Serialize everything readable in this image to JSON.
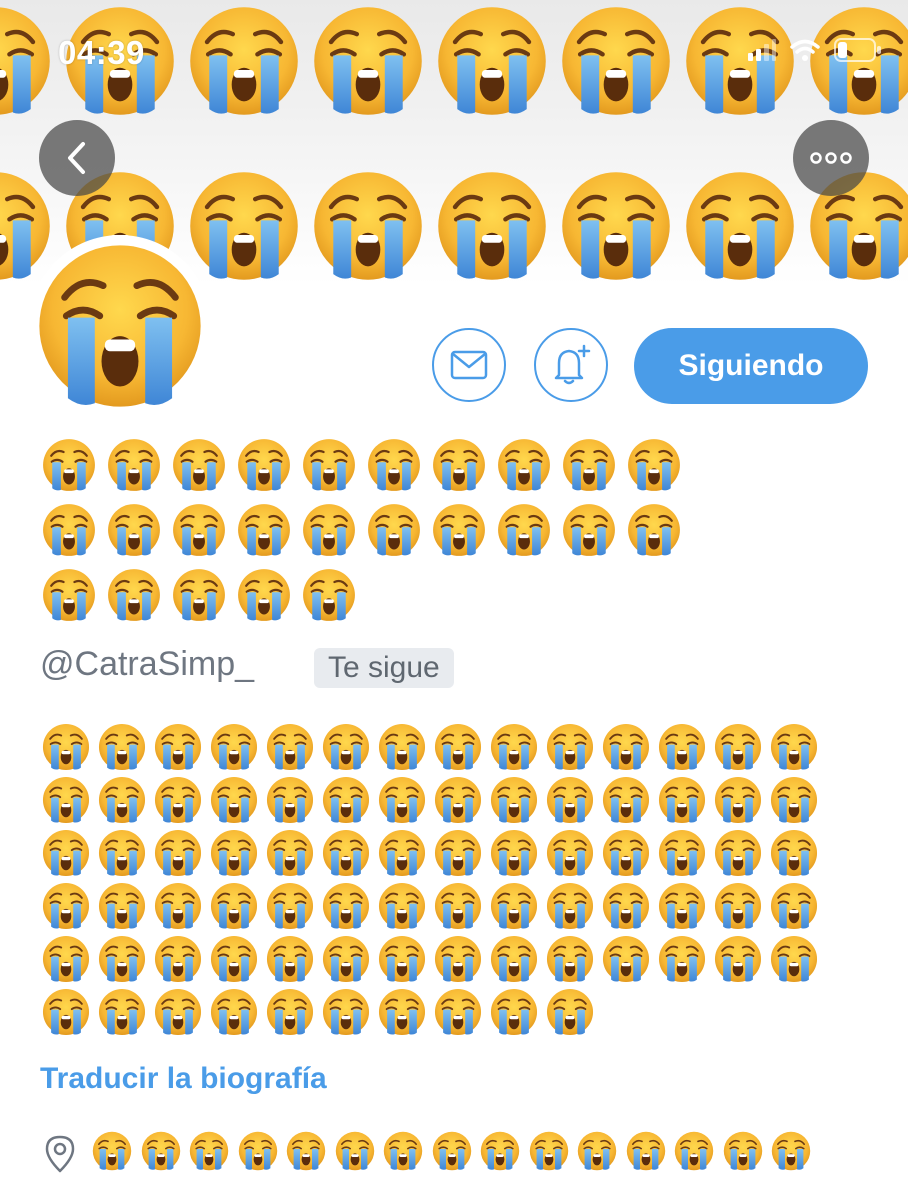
{
  "status_bar": {
    "time": "04:39",
    "icons": [
      "signal-icon",
      "wifi-icon",
      "battery-icon"
    ]
  },
  "nav": {
    "back_icon": "chevron-left-icon",
    "more_icon": "ellipsis-icon"
  },
  "banner": {
    "emoji": "😭",
    "rows": 2
  },
  "profile": {
    "avatar_emoji": "😭",
    "display_name_emoji": "😭",
    "display_name_rows": [
      10,
      10,
      5
    ],
    "handle": "@CatraSimp_",
    "follows_you_badge": "Te sigue",
    "bio_emoji": "😭",
    "bio_rows": [
      14,
      14,
      14,
      14,
      14,
      10
    ],
    "translate_link": "Traducir la biografía",
    "location_icon": "location-pin-icon",
    "location_emoji_count": 15
  },
  "actions": {
    "message_icon": "envelope-icon",
    "notify_icon": "bell-plus-icon",
    "follow_label": "Siguiendo"
  },
  "colors": {
    "accent": "#4a9ce8",
    "handle_gray": "#6e7681",
    "badge_bg": "#e8ebef"
  }
}
